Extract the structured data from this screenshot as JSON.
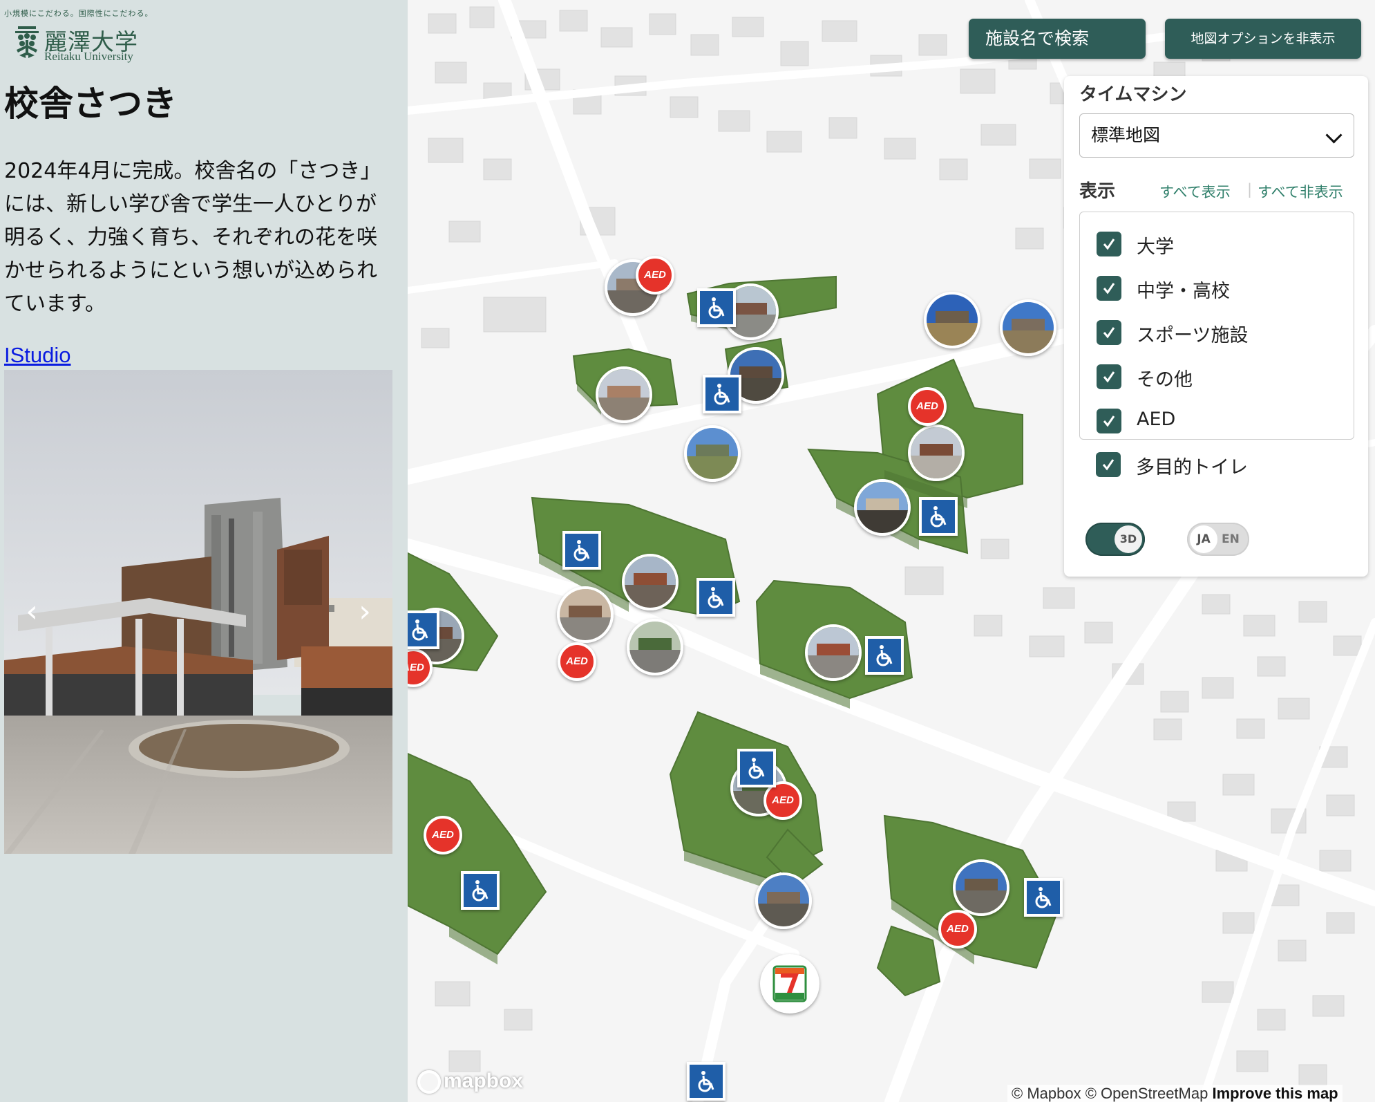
{
  "header": {
    "tagline": "小規模にこだわる。国際性にこだわる。",
    "logo_ja": "麗澤大学",
    "logo_en": "Reitaku University"
  },
  "facility": {
    "title": "校舎さつき",
    "description": "2024年4月に完成。校舎名の「さつき」には、新しい学び舎で学生一人ひとりが明るく、力強く育ち、それぞれの花を咲かせられるようにという想いが込められています。",
    "link_label": "IStudio",
    "carousel": {
      "prev": "‹",
      "next": "›"
    }
  },
  "toolbar": {
    "search_label": "施設名で検索",
    "options_label": "地図オプションを非表示"
  },
  "options": {
    "timemachine_label": "タイムマシン",
    "timemachine_selected": "標準地図",
    "display_label": "表示",
    "show_all": "すべて表示",
    "separator": "|",
    "hide_all": "すべて非表示",
    "layers": [
      {
        "label": "大学",
        "checked": true
      },
      {
        "label": "中学・高校",
        "checked": true
      },
      {
        "label": "スポーツ施設",
        "checked": true
      },
      {
        "label": "その他",
        "checked": true
      },
      {
        "label": "AED",
        "checked": true
      },
      {
        "label": "多目的トイレ",
        "checked": true
      }
    ],
    "toggle_3d": {
      "label": "3D",
      "on": true
    },
    "toggle_lang": {
      "active": "JA",
      "inactive": "EN"
    }
  },
  "map": {
    "aed_label": "AED",
    "seven_eleven_label": "ELEVEn",
    "building_color": "#5f8c3f",
    "accent_color": "#2f5d58",
    "aed_color": "#e5332a",
    "wc_color": "#1f5ea8"
  },
  "footer": {
    "mapbox_logo": "mapbox",
    "attribution": "© Mapbox © OpenStreetMap",
    "improve": "Improve this map"
  }
}
